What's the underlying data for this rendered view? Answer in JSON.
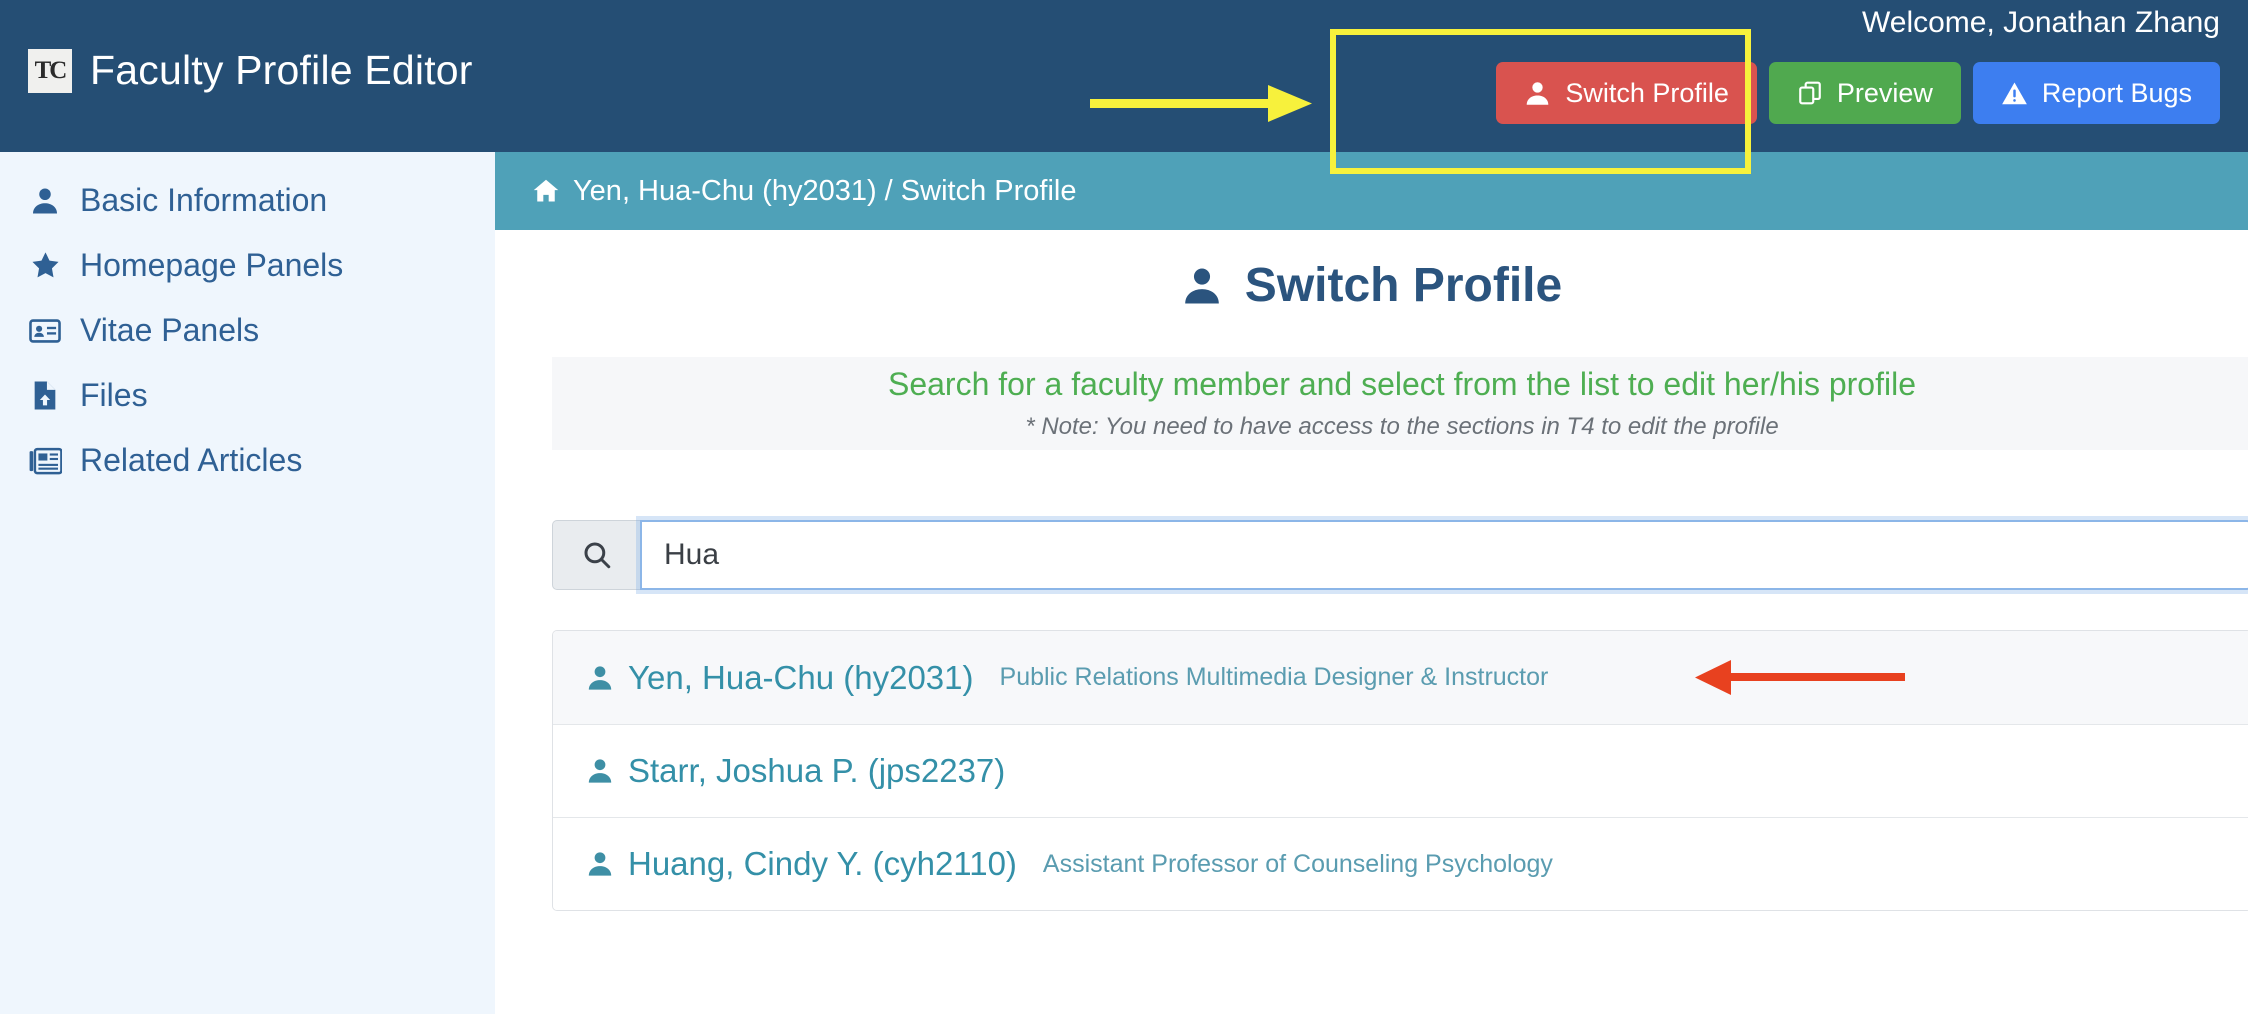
{
  "navbar": {
    "logo_text": "TC",
    "logo_icon": "tc-monogram-icon",
    "title": "Faculty Profile Editor",
    "welcome": "Welcome, Jonathan Zhang",
    "buttons": [
      {
        "label": "Switch Profile",
        "icon": "user-icon",
        "color": "#d9534f"
      },
      {
        "label": "Preview",
        "icon": "clone-icon",
        "color": "#50a94f"
      },
      {
        "label": "Report Bugs",
        "icon": "warning-icon",
        "color": "#3d7ef0"
      }
    ]
  },
  "sidebar": {
    "items": [
      {
        "label": "Basic Information",
        "icon": "user-icon"
      },
      {
        "label": "Homepage Panels",
        "icon": "star-icon"
      },
      {
        "label": "Vitae Panels",
        "icon": "id-card-icon"
      },
      {
        "label": "Files",
        "icon": "file-upload-icon"
      },
      {
        "label": "Related Articles",
        "icon": "newspaper-icon"
      }
    ]
  },
  "breadcrumb": {
    "icon": "home-icon",
    "text": "Yen, Hua-Chu (hy2031) / Switch Profile"
  },
  "main": {
    "title": "Switch Profile",
    "title_icon": "user-icon",
    "panel": {
      "heading": "Search for a faculty member and select from the list to edit her/his profile",
      "note": "* Note: You need to have access to the sections in T4 to edit the profile"
    },
    "search": {
      "icon": "search-icon",
      "value": "Hua",
      "placeholder": ""
    },
    "results": [
      {
        "icon": "user-icon",
        "name": "Yen, Hua-Chu (hy2031)",
        "title": "Public Relations Multimedia Designer & Instructor",
        "active": true
      },
      {
        "icon": "user-icon",
        "name": "Starr, Joshua P. (jps2237)",
        "title": "",
        "active": false
      },
      {
        "icon": "user-icon",
        "name": "Huang, Cindy Y. (cyh2110)",
        "title": "Assistant Professor of Counseling Psychology",
        "active": false
      }
    ]
  },
  "annotations": {
    "highlight_box_color": "#f7f13c",
    "arrow_yellow_color": "#f7f13c",
    "arrow_red_color": "#e8411f"
  },
  "colors": {
    "navbar_bg": "#254e74",
    "sidebar_bg": "#eff6fd",
    "breadcrumb_bg": "#4fa1b8",
    "panel_bg": "#f6f7f9",
    "heading_green": "#4eae52",
    "link_teal": "#3490a8",
    "title_blue": "#2b547e"
  }
}
